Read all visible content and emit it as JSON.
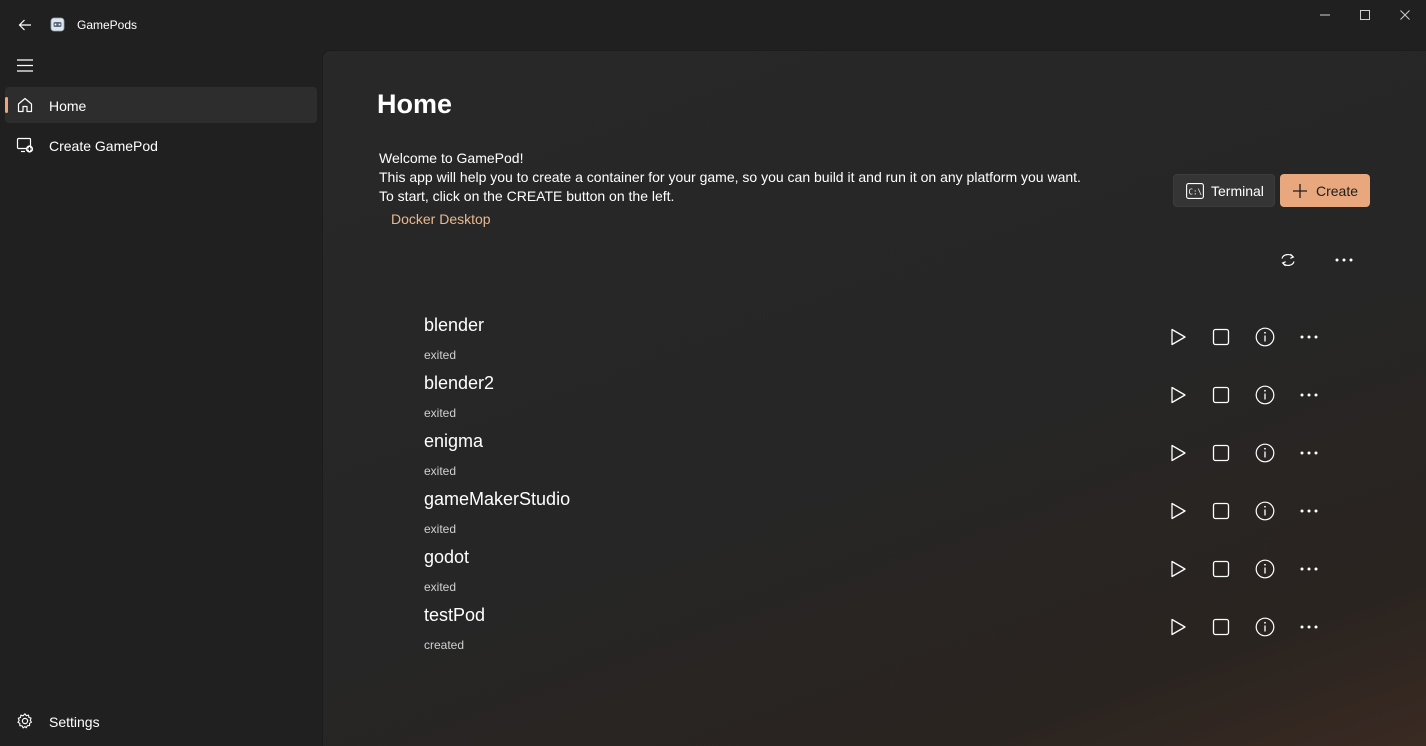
{
  "window": {
    "title": "GamePods",
    "back_icon": "back-arrow-icon",
    "app_icon": "gamepods-app-icon",
    "controls": [
      "minimize-icon",
      "maximize-icon",
      "close-icon"
    ]
  },
  "sidebar": {
    "menu_icon": "hamburger-menu-icon",
    "items": [
      {
        "label": "Home",
        "icon": "home-icon",
        "active": true
      },
      {
        "label": "Create GamePod",
        "icon": "create-gamepod-icon",
        "active": false
      }
    ],
    "footer": {
      "label": "Settings",
      "icon": "gear-icon"
    }
  },
  "main": {
    "title": "Home",
    "welcome_lines": [
      "Welcome to GamePod!",
      "This app will help you to create a container for your game, so you can build it and run it on any platform you want.",
      "To start, click on the CREATE button on the left."
    ],
    "docker_link": "Docker Desktop",
    "terminal_button": "Terminal",
    "create_button": "Create",
    "toolbar_icons": [
      "refresh-icon",
      "more-icon"
    ],
    "pods": [
      {
        "name": "blender",
        "status": "exited"
      },
      {
        "name": "blender2",
        "status": "exited"
      },
      {
        "name": "enigma",
        "status": "exited"
      },
      {
        "name": "gameMakerStudio",
        "status": "exited"
      },
      {
        "name": "godot",
        "status": "exited"
      },
      {
        "name": "testPod",
        "status": "created"
      }
    ],
    "pod_action_icons": [
      "play-icon",
      "stop-icon",
      "info-icon",
      "more-icon"
    ]
  },
  "colors": {
    "accent": "#e8a77c",
    "link": "#e8b98f",
    "background": "#202020",
    "content": "#282828"
  }
}
